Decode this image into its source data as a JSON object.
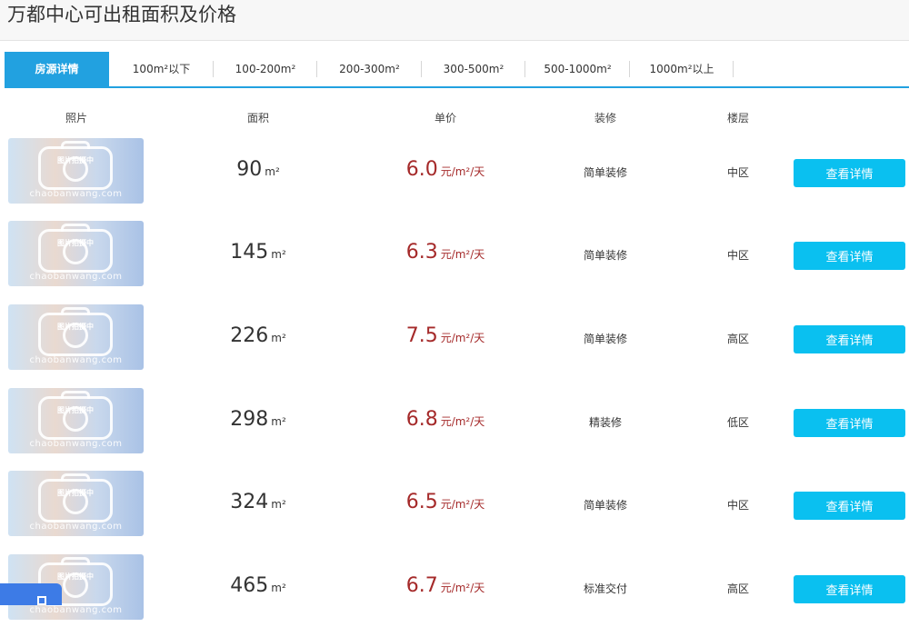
{
  "header": {
    "title": "万都中心可出租面积及价格"
  },
  "tabs": [
    {
      "label": "房源详情",
      "active": true
    },
    {
      "label": "100m²以下"
    },
    {
      "label": "100-200m²"
    },
    {
      "label": "200-300m²"
    },
    {
      "label": "300-500m²"
    },
    {
      "label": "500-1000m²"
    },
    {
      "label": "1000m²以上"
    }
  ],
  "table": {
    "columns": {
      "photo": "照片",
      "area": "面积",
      "price": "单价",
      "decoration": "装修",
      "floor": "楼层"
    },
    "photo_placeholder": {
      "label": "图片拍摄中",
      "site": "chaobanwang.com"
    },
    "area_unit": "m²",
    "price_unit": "元/m²/天",
    "detail_button": "查看详情",
    "rows": [
      {
        "area": "90",
        "price": "6.0",
        "decoration": "简单装修",
        "floor": "中区"
      },
      {
        "area": "145",
        "price": "6.3",
        "decoration": "简单装修",
        "floor": "中区"
      },
      {
        "area": "226",
        "price": "7.5",
        "decoration": "简单装修",
        "floor": "高区"
      },
      {
        "area": "298",
        "price": "6.8",
        "decoration": "精装修",
        "floor": "低区"
      },
      {
        "area": "324",
        "price": "6.5",
        "decoration": "简单装修",
        "floor": "中区"
      },
      {
        "area": "465",
        "price": "6.7",
        "decoration": "标准交付",
        "floor": "高区"
      }
    ]
  },
  "colors": {
    "accent": "#22a1e0",
    "button": "#0ac0f0",
    "price": "#a52a2a"
  }
}
